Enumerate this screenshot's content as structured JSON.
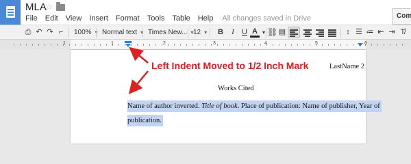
{
  "app": {
    "title": "MLA",
    "menu": [
      "File",
      "Edit",
      "View",
      "Insert",
      "Format",
      "Tools",
      "Table",
      "Help"
    ],
    "save_status": "All changes saved in Drive",
    "comments_label": "Comm"
  },
  "toolbar": {
    "zoom": "100%",
    "style": "Normal text",
    "font": "Times New...",
    "font_size": "12",
    "bold": "B",
    "italic": "I",
    "underline": "U",
    "text_color": "A"
  },
  "ruler": {
    "numbers": [
      "1",
      "1",
      "2",
      "3",
      "4",
      "5",
      "6"
    ],
    "left_indent_inches": 0.5
  },
  "document": {
    "header_lastname": "LastName 2",
    "heading": "Works Cited",
    "citation_line1_a": "Name of author inverted. ",
    "citation_line1_b": "Title of book",
    "citation_line1_c": ". Place of publication: Name of publisher, Year of",
    "citation_line2": "publication."
  },
  "annotation": {
    "text": "Left Indent Moved to 1/2 Inch Mark",
    "color": "#e02020"
  },
  "colors": {
    "docs_blue": "#4a88d8",
    "selection": "#c3d4f2",
    "indent_marker": "#2e7de0"
  }
}
